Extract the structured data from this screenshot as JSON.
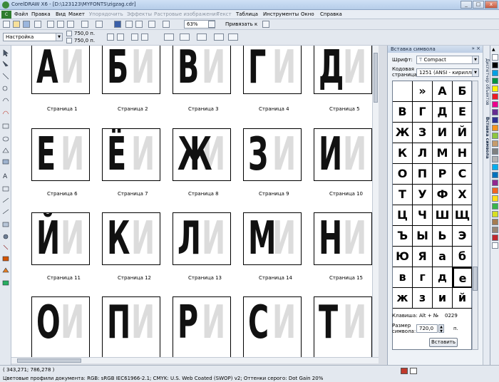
{
  "window": {
    "title": "CorelDRAW X6 - [D:\\123123\\MYFONTS\\zigzag.cdr]",
    "btn_min": "_",
    "btn_max": "□",
    "btn_close": "x"
  },
  "menu": {
    "items": [
      "Файл",
      "Правка",
      "Вид",
      "Макет",
      "Упорядочить",
      "Эффекты",
      "Растровые изображения",
      "Текст",
      "Таблица",
      "Инструменты",
      "Окно",
      "Справка"
    ]
  },
  "toolbar": {
    "zoom": "63%",
    "snap": "Привязать к",
    "preset": "Настройка",
    "width": "750,0 п.",
    "height": "750,0 п."
  },
  "pages": [
    {
      "glyph": "А",
      "label": "Страница  1"
    },
    {
      "glyph": "Б",
      "label": "Страница  2"
    },
    {
      "glyph": "В",
      "label": "Страница  3"
    },
    {
      "glyph": "Г",
      "label": "Страница  4"
    },
    {
      "glyph": "Д",
      "label": "Страница  5"
    },
    {
      "glyph": "Е",
      "label": "Страница  6"
    },
    {
      "glyph": "Ё",
      "label": "Страница  7"
    },
    {
      "glyph": "Ж",
      "label": "Страница  8"
    },
    {
      "glyph": "З",
      "label": "Страница  9"
    },
    {
      "glyph": "И",
      "label": "Страница  10"
    },
    {
      "glyph": "Й",
      "label": "Страница  11"
    },
    {
      "glyph": "К",
      "label": "Страница  12"
    },
    {
      "glyph": "Л",
      "label": "Страница  13"
    },
    {
      "glyph": "М",
      "label": "Страница  14"
    },
    {
      "glyph": "Н",
      "label": "Страница  15"
    },
    {
      "glyph": "О",
      "label": ""
    },
    {
      "glyph": "П",
      "label": ""
    },
    {
      "glyph": "Р",
      "label": ""
    },
    {
      "glyph": "С",
      "label": ""
    },
    {
      "glyph": "Т",
      "label": ""
    }
  ],
  "ghost_glyph": "И",
  "docker": {
    "title": "Вставка символа",
    "font_label": "Шрифт:",
    "font_value": "Compact",
    "codepage_label1": "Кодовая",
    "codepage_label2": "страница:",
    "codepage_value": "1251  (ANSI - кириллица)",
    "grid": [
      "",
      "»",
      "А",
      "Б",
      "В",
      "Г",
      "Д",
      "Е",
      "Ж",
      "З",
      "И",
      "Й",
      "К",
      "Л",
      "М",
      "Н",
      "О",
      "П",
      "Р",
      "С",
      "Т",
      "У",
      "Ф",
      "Х",
      "Ц",
      "Ч",
      "Ш",
      "Щ",
      "Ъ",
      "Ы",
      "Ь",
      "Э",
      "Ю",
      "Я",
      "а",
      "б",
      "в",
      "г",
      "д",
      "е",
      "ж",
      "з",
      "и",
      "й"
    ],
    "selected_index": 39,
    "key_label": "Клавиша:",
    "key_value": "Alt + №",
    "key_code": "0229",
    "size_label1": "Размер",
    "size_label2": "символа:",
    "size_value": "720,0",
    "size_unit": "п.",
    "insert_btn": "Вставить"
  },
  "side_tabs": [
    "Диспетчер объектов",
    "Вставка символа"
  ],
  "palette_colors": [
    "#ffffff",
    "#000000",
    "#00a0e3",
    "#00923f",
    "#fff200",
    "#ed1c24",
    "#ec008c",
    "#662d91",
    "#2e3192",
    "#f7941d",
    "#8dc63f",
    "#c69c6d",
    "#808080",
    "#b3b3b3",
    "#00aeef",
    "#0072bc",
    "#92278f",
    "#f26522",
    "#ffde17",
    "#39b54a",
    "#d7df23",
    "#a67c52",
    "#998675",
    "#c1272d",
    "#ffffff"
  ],
  "status": {
    "coords": "( 343,271; 786,278 )",
    "profile": "Цветовые профили документа: RGB: sRGB IEC61966-2.1; CMYK: U.S. Web Coated (SWOP) v2; Оттенки серого: Dot Gain 20%"
  }
}
